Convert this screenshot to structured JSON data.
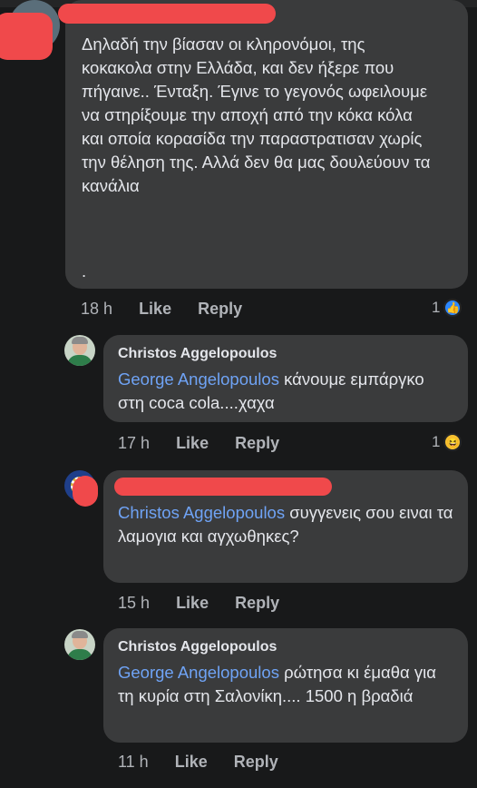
{
  "comments": [
    {
      "text": "Δηλαδή την βίασαν οι κληρονόμοι, της κοκακολα στην Ελλάδα, και δεν ήξερε που πήγαινε.. Ένταξη. Έγινε το γεγονός ωφειλουμε να στηρίξουμε την αποχή από την κόκα κόλα και οποία κορασίδα την παραστρατισαν χωρίς την θέληση της. Αλλά δεν θα μας δουλεύουν τα κανάλια",
      "trailing": ".",
      "time": "18 h",
      "like_label": "Like",
      "reply_label": "Reply",
      "reaction_count": "1"
    },
    {
      "author": "Christos Aggelopoulos",
      "mention": "George Angelopoulos",
      "text": " κάνουμε εμπάργκο στη coca cola....χαχα",
      "time": "17 h",
      "like_label": "Like",
      "reply_label": "Reply",
      "reaction_count": "1"
    },
    {
      "mention": "Christos Aggelopoulos",
      "text": " συγγενεις σου ειναι τα λαμογια και αγχωθηκες?",
      "time": "15 h",
      "like_label": "Like",
      "reply_label": "Reply"
    },
    {
      "author": "Christos Aggelopoulos",
      "mention": "George Angelopoulos",
      "text": " ρώτησα κι έμαθα για τη κυρία στη Σαλονίκη.... 1500 η βραδιά",
      "time": "11 h",
      "like_label": "Like",
      "reply_label": "Reply"
    }
  ],
  "icons": {
    "like": "thumbs-up-icon",
    "haha": "laughing-face-icon"
  },
  "colors": {
    "background": "#18191a",
    "bubble": "#3a3b3c",
    "mention": "#6fa3f5",
    "redaction": "#f0494b"
  }
}
